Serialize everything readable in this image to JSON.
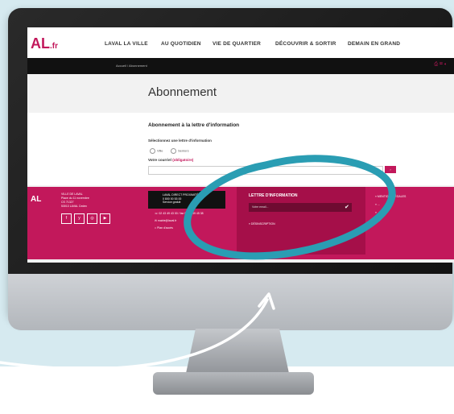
{
  "nav": {
    "logo_text": "AL",
    "logo_suffix": ".fr",
    "items": [
      "LAVAL LA VILLE",
      "AU QUOTIDIEN",
      "VIE DE QUARTIER",
      "DÉCOUVRIR & SORTIR",
      "DEMAIN EN GRAND"
    ]
  },
  "breadcrumb": "Accueil / Abonnement",
  "page": {
    "title": "Abonnement",
    "section_title": "Abonnement à la lettre d'information",
    "select_label": "Sélectionnez une lettre d'information",
    "options": [
      "Ville",
      "Seniors"
    ],
    "email_label": "Votre courriel",
    "required": "(obligatoire)"
  },
  "footer": {
    "logo_text": "AL",
    "address": [
      "VILLE DE LAVAL",
      "Place du 11 novembre",
      "CS 71327",
      "53013 LAVAL Cedex"
    ],
    "social": [
      "f",
      "y",
      "◎",
      "▶"
    ],
    "contact_box": [
      "LAVAL DIRECT PROXIMITÉ",
      "0 800 00 53 00",
      "Service gratuit"
    ],
    "phone": "02 43 49 43 00 / fax 02 43 49 45 38",
    "mail": "mairie@laval.fr",
    "plan": "Plan d'accès",
    "newsletter_title": "LETTRE D'INFORMATION",
    "newsletter_placeholder": "Votre email...",
    "newsletter_unsub": "» DÉSINSCRIPTION",
    "links": [
      "» MENTIONS LÉGALES",
      "» ...",
      "» ...",
      "» ..."
    ]
  },
  "colors": {
    "brand": "#c2185b",
    "annotation": "#2a9db3"
  }
}
